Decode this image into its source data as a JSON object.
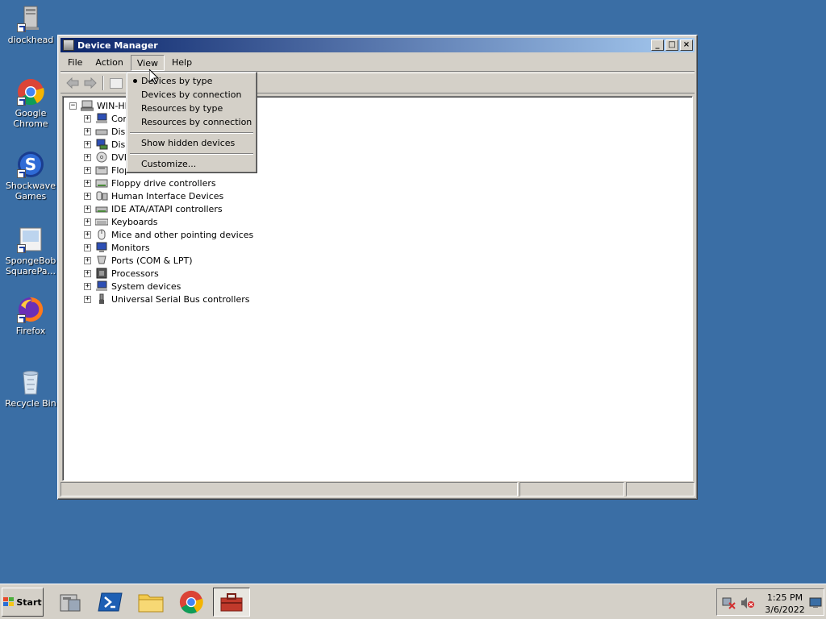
{
  "desktop": {
    "icons": [
      {
        "label": "diockhead",
        "icon": "computer-icon"
      },
      {
        "label": "Google Chrome",
        "icon": "chrome-icon"
      },
      {
        "label": "Shockwave Games",
        "icon": "shockwave-icon"
      },
      {
        "label": "SpongeBob SquarePa...",
        "icon": "spongebob-icon"
      },
      {
        "label": "Firefox",
        "icon": "firefox-icon"
      },
      {
        "label": "Recycle Bin",
        "icon": "recycle-bin-icon"
      }
    ]
  },
  "window": {
    "title": "Device Manager",
    "menu": [
      {
        "label": "File"
      },
      {
        "label": "Action"
      },
      {
        "label": "View",
        "active": true
      },
      {
        "label": "Help"
      }
    ],
    "tree": {
      "root": "WIN-HI",
      "items": [
        {
          "label": "Com"
        },
        {
          "label": "Disk"
        },
        {
          "label": "Disp"
        },
        {
          "label": "DVD"
        },
        {
          "label": "Flop"
        },
        {
          "label": "Floppy drive controllers"
        },
        {
          "label": "Human Interface Devices"
        },
        {
          "label": "IDE ATA/ATAPI controllers"
        },
        {
          "label": "Keyboards"
        },
        {
          "label": "Mice and other pointing devices"
        },
        {
          "label": "Monitors"
        },
        {
          "label": "Ports (COM & LPT)"
        },
        {
          "label": "Processors"
        },
        {
          "label": "System devices"
        },
        {
          "label": "Universal Serial Bus controllers"
        }
      ]
    }
  },
  "view_menu": {
    "items": [
      {
        "label": "Devices by type",
        "checked": true
      },
      {
        "label": "Devices by connection"
      },
      {
        "label": "Resources by type"
      },
      {
        "label": "Resources by connection"
      },
      {
        "label": "Show hidden devices"
      },
      {
        "label": "Customize..."
      }
    ]
  },
  "taskbar": {
    "start_label": "Start",
    "apps": [
      "server-manager-icon",
      "powershell-icon",
      "explorer-icon",
      "chrome-icon",
      "toolbox-icon"
    ],
    "clock": {
      "time": "1:25 PM",
      "date": "3/6/2022"
    }
  },
  "colors": {
    "desktop": "#3a6ea5",
    "title_start": "#0a246a",
    "title_end": "#a6caf0",
    "chrome_face": "#d4d0c8"
  }
}
